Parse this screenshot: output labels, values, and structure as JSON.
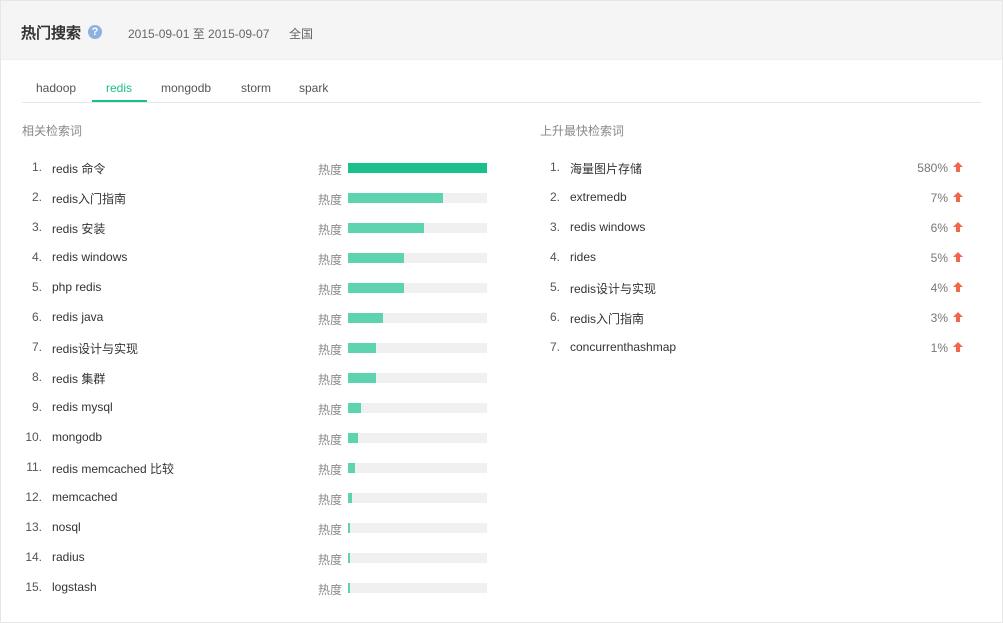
{
  "header": {
    "title": "热门搜索",
    "help_icon": "question-circle-icon",
    "date_range": "2015-09-01 至 2015-09-07",
    "region": "全国"
  },
  "tabs": [
    {
      "label": "hadoop",
      "active": false
    },
    {
      "label": "redis",
      "active": true
    },
    {
      "label": "mongodb",
      "active": false
    },
    {
      "label": "storm",
      "active": false
    },
    {
      "label": "spark",
      "active": false
    }
  ],
  "related": {
    "title": "相关检索词",
    "heat_label": "热度",
    "items": [
      {
        "index": "1.",
        "term": "redis 命令",
        "heat": 1.0
      },
      {
        "index": "2.",
        "term": "redis入门指南",
        "heat": 0.68
      },
      {
        "index": "3.",
        "term": "redis 安装",
        "heat": 0.55
      },
      {
        "index": "4.",
        "term": "redis windows",
        "heat": 0.4
      },
      {
        "index": "5.",
        "term": "php redis",
        "heat": 0.4
      },
      {
        "index": "6.",
        "term": "redis java",
        "heat": 0.25
      },
      {
        "index": "7.",
        "term": "redis设计与实现",
        "heat": 0.2
      },
      {
        "index": "8.",
        "term": "redis 集群",
        "heat": 0.2
      },
      {
        "index": "9.",
        "term": "redis mysql",
        "heat": 0.09
      },
      {
        "index": "10.",
        "term": "mongodb",
        "heat": 0.07
      },
      {
        "index": "11.",
        "term": "redis memcached 比较",
        "heat": 0.05
      },
      {
        "index": "12.",
        "term": "memcached",
        "heat": 0.03
      },
      {
        "index": "13.",
        "term": "nosql",
        "heat": 0.01
      },
      {
        "index": "14.",
        "term": "radius",
        "heat": 0.01
      },
      {
        "index": "15.",
        "term": "logstash",
        "heat": 0.01
      }
    ]
  },
  "rising": {
    "title": "上升最快检索词",
    "items": [
      {
        "index": "1.",
        "term": "海量图片存储",
        "change": "580%"
      },
      {
        "index": "2.",
        "term": "extremedb",
        "change": "7%"
      },
      {
        "index": "3.",
        "term": "redis windows",
        "change": "6%"
      },
      {
        "index": "4.",
        "term": "rides",
        "change": "5%"
      },
      {
        "index": "5.",
        "term": "redis设计与实现",
        "change": "4%"
      },
      {
        "index": "6.",
        "term": "redis入门指南",
        "change": "3%"
      },
      {
        "index": "7.",
        "term": "concurrenthashmap",
        "change": "1%"
      }
    ]
  },
  "colors": {
    "accent": "#1bbf8b",
    "bar": "#5dd3b0",
    "arrow": "#f0674b"
  }
}
